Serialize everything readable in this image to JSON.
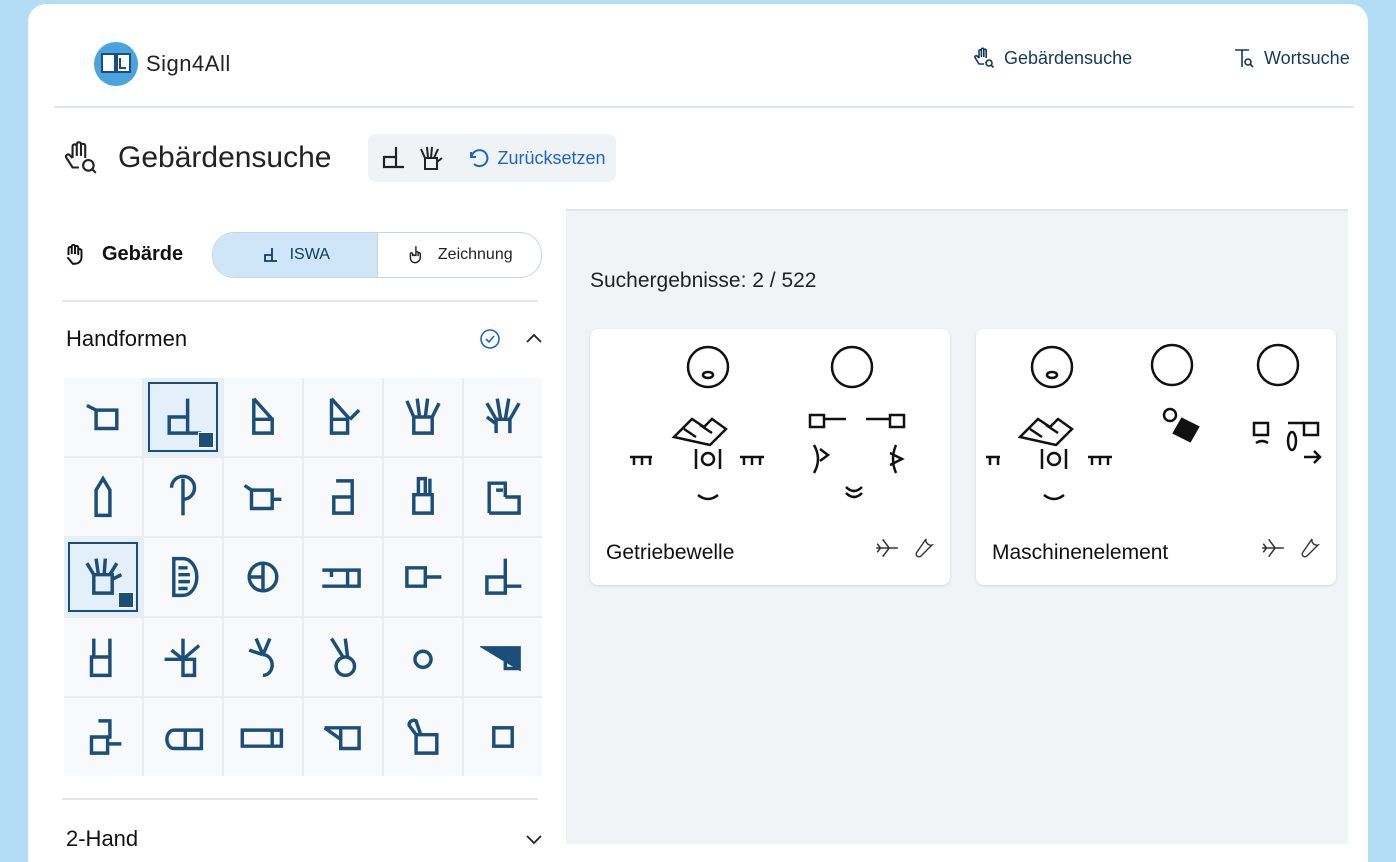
{
  "app": {
    "name": "Sign4All"
  },
  "nav": {
    "sign_search": "Gebärdensuche",
    "word_search": "Wortsuche"
  },
  "header": {
    "title": "Gebärdensuche",
    "reset_label": "Zurücksetzen"
  },
  "gesture_panel": {
    "title": "Gebärde",
    "modes": [
      "ISWA",
      "Zeichnung"
    ],
    "active_mode": "ISWA"
  },
  "handforms": {
    "title": "Handformen",
    "selected_count": 2
  },
  "section_2hand": {
    "title": "2-Hand"
  },
  "results": {
    "label": "Suchergebnisse: 2 / 522"
  },
  "cards": [
    {
      "name": "Getriebewelle"
    },
    {
      "name": "Maschinenelement"
    }
  ],
  "colors": {
    "accent": "#1b4f7a",
    "link": "#1e64c8",
    "background": "#b3dcf5"
  }
}
